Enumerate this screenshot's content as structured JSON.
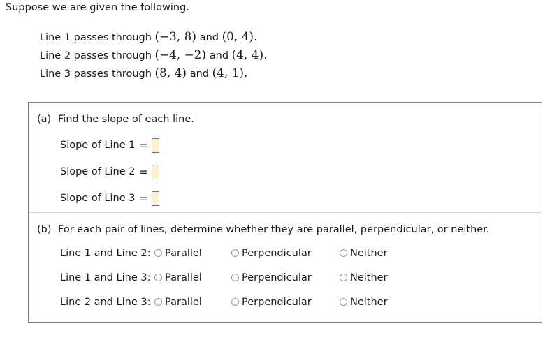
{
  "intro": "Suppose we are given the following.",
  "given": [
    {
      "prefix": "Line 1 passes through",
      "point1": "(−3, 8)",
      "conj": "and",
      "point2": "(0, 4)",
      "period": "."
    },
    {
      "prefix": "Line 2 passes through",
      "point1": "(−4, −2)",
      "conj": "and",
      "point2": "(4, 4)",
      "period": "."
    },
    {
      "prefix": "Line 3 passes through",
      "point1": "(8, 4)",
      "conj": "and",
      "point2": "(4, 1)",
      "period": "."
    }
  ],
  "part_a": {
    "letter": "(a)",
    "prompt": "Find the slope of each line.",
    "rows": [
      {
        "label": "Slope of Line 1",
        "equals": "=",
        "value": ""
      },
      {
        "label": "Slope of Line 2",
        "equals": "=",
        "value": ""
      },
      {
        "label": "Slope of Line 3",
        "equals": "=",
        "value": ""
      }
    ]
  },
  "part_b": {
    "letter": "(b)",
    "prompt": "For each pair of lines, determine whether they are parallel, perpendicular, or neither.",
    "options": [
      "Parallel",
      "Perpendicular",
      "Neither"
    ],
    "rows": [
      {
        "label": "Line 1 and Line 2:",
        "selected": ""
      },
      {
        "label": "Line 1 and Line 3:",
        "selected": ""
      },
      {
        "label": "Line 2 and Line 3:",
        "selected": ""
      }
    ]
  },
  "colors": {
    "background": "#ffffff",
    "text": "#1a1a1a",
    "box_border": "#7d7d7d",
    "divider": "#d4d4d4",
    "input_fill": "#fdf3c8",
    "input_border": "#6b5fa8",
    "radio_border": "#9a9a9a"
  }
}
